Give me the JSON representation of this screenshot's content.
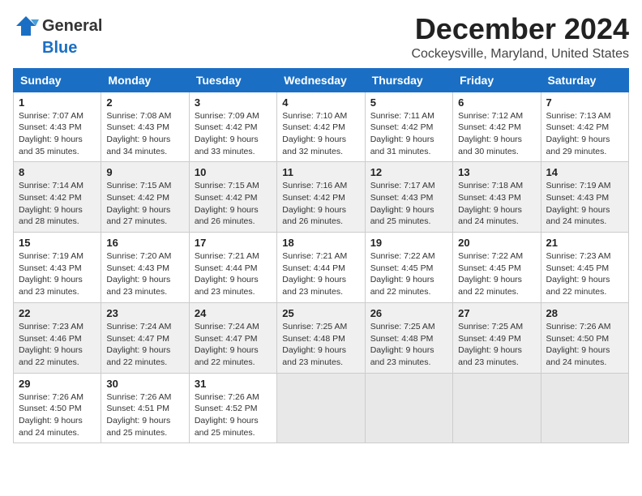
{
  "logo": {
    "line1": "General",
    "line2": "Blue"
  },
  "title": "December 2024",
  "location": "Cockeysville, Maryland, United States",
  "weekdays": [
    "Sunday",
    "Monday",
    "Tuesday",
    "Wednesday",
    "Thursday",
    "Friday",
    "Saturday"
  ],
  "weeks": [
    [
      {
        "day": "1",
        "sunrise": "7:07 AM",
        "sunset": "4:43 PM",
        "daylight": "9 hours and 35 minutes."
      },
      {
        "day": "2",
        "sunrise": "7:08 AM",
        "sunset": "4:43 PM",
        "daylight": "9 hours and 34 minutes."
      },
      {
        "day": "3",
        "sunrise": "7:09 AM",
        "sunset": "4:42 PM",
        "daylight": "9 hours and 33 minutes."
      },
      {
        "day": "4",
        "sunrise": "7:10 AM",
        "sunset": "4:42 PM",
        "daylight": "9 hours and 32 minutes."
      },
      {
        "day": "5",
        "sunrise": "7:11 AM",
        "sunset": "4:42 PM",
        "daylight": "9 hours and 31 minutes."
      },
      {
        "day": "6",
        "sunrise": "7:12 AM",
        "sunset": "4:42 PM",
        "daylight": "9 hours and 30 minutes."
      },
      {
        "day": "7",
        "sunrise": "7:13 AM",
        "sunset": "4:42 PM",
        "daylight": "9 hours and 29 minutes."
      }
    ],
    [
      {
        "day": "8",
        "sunrise": "7:14 AM",
        "sunset": "4:42 PM",
        "daylight": "9 hours and 28 minutes."
      },
      {
        "day": "9",
        "sunrise": "7:15 AM",
        "sunset": "4:42 PM",
        "daylight": "9 hours and 27 minutes."
      },
      {
        "day": "10",
        "sunrise": "7:15 AM",
        "sunset": "4:42 PM",
        "daylight": "9 hours and 26 minutes."
      },
      {
        "day": "11",
        "sunrise": "7:16 AM",
        "sunset": "4:42 PM",
        "daylight": "9 hours and 26 minutes."
      },
      {
        "day": "12",
        "sunrise": "7:17 AM",
        "sunset": "4:43 PM",
        "daylight": "9 hours and 25 minutes."
      },
      {
        "day": "13",
        "sunrise": "7:18 AM",
        "sunset": "4:43 PM",
        "daylight": "9 hours and 24 minutes."
      },
      {
        "day": "14",
        "sunrise": "7:19 AM",
        "sunset": "4:43 PM",
        "daylight": "9 hours and 24 minutes."
      }
    ],
    [
      {
        "day": "15",
        "sunrise": "7:19 AM",
        "sunset": "4:43 PM",
        "daylight": "9 hours and 23 minutes."
      },
      {
        "day": "16",
        "sunrise": "7:20 AM",
        "sunset": "4:43 PM",
        "daylight": "9 hours and 23 minutes."
      },
      {
        "day": "17",
        "sunrise": "7:21 AM",
        "sunset": "4:44 PM",
        "daylight": "9 hours and 23 minutes."
      },
      {
        "day": "18",
        "sunrise": "7:21 AM",
        "sunset": "4:44 PM",
        "daylight": "9 hours and 23 minutes."
      },
      {
        "day": "19",
        "sunrise": "7:22 AM",
        "sunset": "4:45 PM",
        "daylight": "9 hours and 22 minutes."
      },
      {
        "day": "20",
        "sunrise": "7:22 AM",
        "sunset": "4:45 PM",
        "daylight": "9 hours and 22 minutes."
      },
      {
        "day": "21",
        "sunrise": "7:23 AM",
        "sunset": "4:45 PM",
        "daylight": "9 hours and 22 minutes."
      }
    ],
    [
      {
        "day": "22",
        "sunrise": "7:23 AM",
        "sunset": "4:46 PM",
        "daylight": "9 hours and 22 minutes."
      },
      {
        "day": "23",
        "sunrise": "7:24 AM",
        "sunset": "4:47 PM",
        "daylight": "9 hours and 22 minutes."
      },
      {
        "day": "24",
        "sunrise": "7:24 AM",
        "sunset": "4:47 PM",
        "daylight": "9 hours and 22 minutes."
      },
      {
        "day": "25",
        "sunrise": "7:25 AM",
        "sunset": "4:48 PM",
        "daylight": "9 hours and 23 minutes."
      },
      {
        "day": "26",
        "sunrise": "7:25 AM",
        "sunset": "4:48 PM",
        "daylight": "9 hours and 23 minutes."
      },
      {
        "day": "27",
        "sunrise": "7:25 AM",
        "sunset": "4:49 PM",
        "daylight": "9 hours and 23 minutes."
      },
      {
        "day": "28",
        "sunrise": "7:26 AM",
        "sunset": "4:50 PM",
        "daylight": "9 hours and 24 minutes."
      }
    ],
    [
      {
        "day": "29",
        "sunrise": "7:26 AM",
        "sunset": "4:50 PM",
        "daylight": "9 hours and 24 minutes."
      },
      {
        "day": "30",
        "sunrise": "7:26 AM",
        "sunset": "4:51 PM",
        "daylight": "9 hours and 25 minutes."
      },
      {
        "day": "31",
        "sunrise": "7:26 AM",
        "sunset": "4:52 PM",
        "daylight": "9 hours and 25 minutes."
      },
      null,
      null,
      null,
      null
    ]
  ],
  "labels": {
    "sunrise": "Sunrise:",
    "sunset": "Sunset:",
    "daylight": "Daylight:"
  }
}
